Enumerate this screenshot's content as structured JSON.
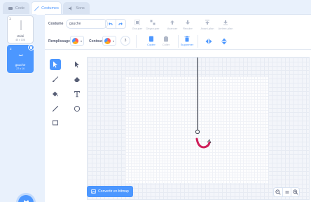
{
  "tabs": {
    "code": "Code",
    "costumes": "Costumes",
    "sounds": "Sons"
  },
  "costumes": [
    {
      "num": "1",
      "name": "Unité",
      "size": "45 x 106"
    },
    {
      "num": "2",
      "name": "gauche",
      "size": "27 x 14"
    }
  ],
  "editor": {
    "costume_label": "Costume",
    "costume_name": "gauche",
    "group_label": "Grouper",
    "ungroup_label": "Dégrouper",
    "forward_label": "Avancer",
    "backward_label": "Reculer",
    "front_label": "Avant-plan",
    "back_label": "Arrière-plan",
    "fill_label": "Remplissage",
    "outline_label": "Contour",
    "outline_width": "3",
    "copy_label": "Copier",
    "paste_label": "Coller",
    "delete_label": "Supprimer",
    "convert_label": "Convertir en bitmap"
  },
  "colors": {
    "accent": "#4c97ff",
    "shape": "#cf1e5a"
  }
}
